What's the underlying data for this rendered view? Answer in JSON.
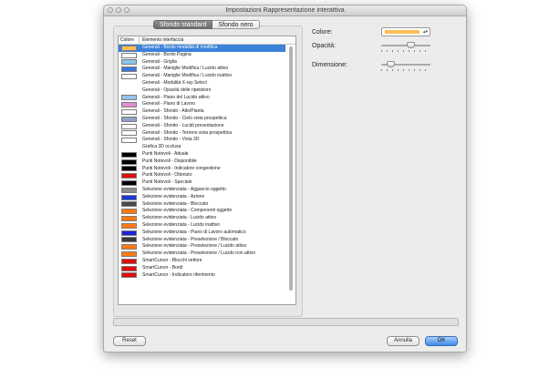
{
  "window": {
    "title": "Impostazioni Rappresentazione interattiva"
  },
  "tabs": [
    {
      "label": "Sfondo standard",
      "selected": true
    },
    {
      "label": "Sfondo nero",
      "selected": false
    }
  ],
  "list": {
    "header_color": "Colore",
    "header_element": "Elemento interfaccia",
    "items": [
      {
        "label": "Generali - Bordo modalità di modifica",
        "color": "#ffbe55",
        "selected": true
      },
      {
        "label": "Generali - Bordo Pagina",
        "color": "#ffffff"
      },
      {
        "label": "Generali - Griglia",
        "color": "#87c6ef"
      },
      {
        "label": "Generali - Maniglie Modifica / Lucido attivo",
        "color": "#3a78d8"
      },
      {
        "label": "Generali - Maniglie Modifica / Lucido inattivo",
        "color": "#ffffff"
      },
      {
        "label": "Generali - Modalità  X-ray Select",
        "color": ""
      },
      {
        "label": "Generali - Opacità delle ripetizioni",
        "color": ""
      },
      {
        "label": "Generali - Piano del Lucido attivo",
        "color": "#92c4ee"
      },
      {
        "label": "Generali - Piano di Lavoro",
        "color": "#e58ad4"
      },
      {
        "label": "Generali - Sfondo - Alto/Pianta",
        "color": "#ffffff"
      },
      {
        "label": "Generali - Sfondo - Cielo vista prospettica",
        "color": "#8da3c9"
      },
      {
        "label": "Generali - Sfondo - Lucidi presentazione",
        "color": "#ffffff"
      },
      {
        "label": "Generali - Sfondo - Terreno vista prospettica",
        "color": "#ffffff"
      },
      {
        "label": "Generali - Sfondo - Vista 3D",
        "color": "#ffffff"
      },
      {
        "label": "Grafica 3D occlusa",
        "color": ""
      },
      {
        "label": "Punti Notevoli - Attuale",
        "color": "#000000"
      },
      {
        "label": "Punti Notevoli - Disponibile",
        "color": "#000000"
      },
      {
        "label": "Punti Notevoli - Indicatore congestione",
        "color": "#000000"
      },
      {
        "label": "Punti Notevoli - Ottenuto",
        "color": "#e00d0d"
      },
      {
        "label": "Punti Notevoli - Speciale",
        "color": "#000000"
      },
      {
        "label": "Selezione evidenziata - Aggancio oggetto",
        "color": "#8c8c8c"
      },
      {
        "label": "Selezione evidenziata - Azione",
        "color": "#1a36d8"
      },
      {
        "label": "Selezione evidenziata - Bloccato",
        "color": "#4a4a4a"
      },
      {
        "label": "Selezione evidenziata - Componenti oggetto",
        "color": "#ff7a12"
      },
      {
        "label": "Selezione evidenziata - Lucido attivo",
        "color": "#ff7a12"
      },
      {
        "label": "Selezione evidenziata - Lucido inattivo",
        "color": "#ff7a12"
      },
      {
        "label": "Selezione evidenziata - Piano di Lavoro automatico",
        "color": "#1a26d8"
      },
      {
        "label": "Selezione evidenziata - Preselezione / Bloccato",
        "color": "#3a3a3a"
      },
      {
        "label": "Selezione evidenziata - Preselezione / Lucido attivo",
        "color": "#ff7a12"
      },
      {
        "label": "Selezione evidenziata - Preselezione / Lucido non attivo",
        "color": "#ff7a12"
      },
      {
        "label": "SmartCursor - Blocchi vettore",
        "color": "#e00d0d"
      },
      {
        "label": "SmartCursor - Bordi",
        "color": "#e00d0d"
      },
      {
        "label": "SmartCursor - Indicatore riferimento",
        "color": "#e00d0d"
      }
    ]
  },
  "settings": {
    "color_label": "Colore:",
    "color_value": "#ffbe55",
    "opacity_label": "Opacità:",
    "opacity_value": 0.6,
    "size_label": "Dimensione:",
    "size_value": 0.2
  },
  "buttons": {
    "reset": "Reset",
    "cancel": "Annulla",
    "ok": "OK"
  }
}
